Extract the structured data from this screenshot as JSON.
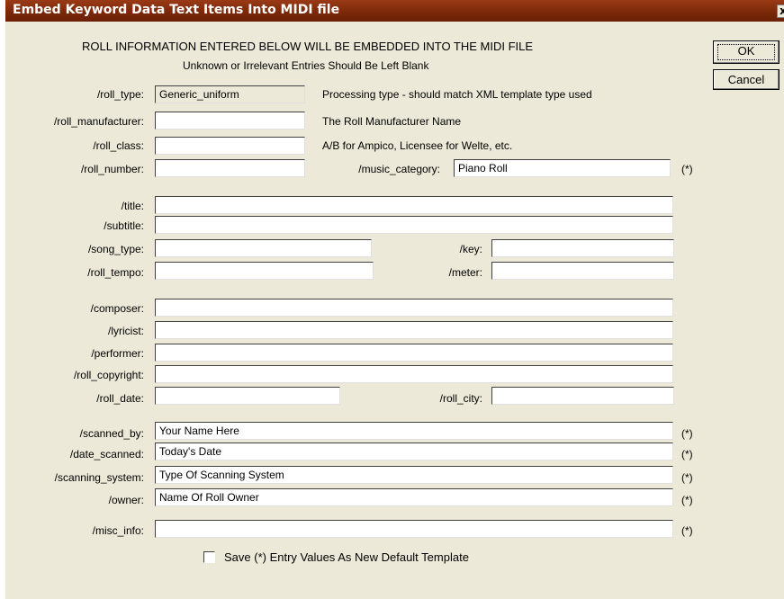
{
  "window": {
    "title": "Embed Keyword Data Text Items Into MIDI file",
    "close_glyph": "x"
  },
  "header": {
    "line1": "ROLL INFORMATION ENTERED BELOW WILL BE EMBEDDED INTO THE MIDI FILE",
    "line2": "Unknown or Irrelevant Entries Should Be Left Blank"
  },
  "buttons": {
    "ok": "OK",
    "cancel": "Cancel"
  },
  "fields": {
    "roll_type": {
      "label": "/roll_type:",
      "value": "Generic_uniform",
      "hint": "Processing type - should match XML template type used"
    },
    "roll_manufacturer": {
      "label": "/roll_manufacturer:",
      "value": "",
      "hint": "The Roll Manufacturer Name"
    },
    "roll_class": {
      "label": "/roll_class:",
      "value": "",
      "hint": "A/B for Ampico, Licensee for Welte, etc."
    },
    "roll_number": {
      "label": "/roll_number:",
      "value": ""
    },
    "music_category": {
      "label": "/music_category:",
      "value": "Piano  Roll"
    },
    "title": {
      "label": "/title:",
      "value": ""
    },
    "subtitle": {
      "label": "/subtitle:",
      "value": ""
    },
    "song_type": {
      "label": "/song_type:",
      "value": ""
    },
    "key": {
      "label": "/key:",
      "value": ""
    },
    "roll_tempo": {
      "label": "/roll_tempo:",
      "value": ""
    },
    "meter": {
      "label": "/meter:",
      "value": ""
    },
    "composer": {
      "label": "/composer:",
      "value": ""
    },
    "lyricist": {
      "label": "/lyricist:",
      "value": ""
    },
    "performer": {
      "label": "/performer:",
      "value": ""
    },
    "roll_copyright": {
      "label": "/roll_copyright:",
      "value": ""
    },
    "roll_date": {
      "label": "/roll_date:",
      "value": ""
    },
    "roll_city": {
      "label": "/roll_city:",
      "value": ""
    },
    "scanned_by": {
      "label": "/scanned_by:",
      "value": "Your Name Here"
    },
    "date_scanned": {
      "label": "/date_scanned:",
      "value": "Today's Date"
    },
    "scanning_system": {
      "label": "/scanning_system:",
      "value": "Type Of Scanning System"
    },
    "owner": {
      "label": "/owner:",
      "value": "Name Of Roll Owner"
    },
    "misc_info": {
      "label": "/misc_info:",
      "value": ""
    }
  },
  "template_marker": "(*)",
  "save_checkbox": {
    "label": "Save (*) Entry Values As New Default Template",
    "checked": false
  }
}
